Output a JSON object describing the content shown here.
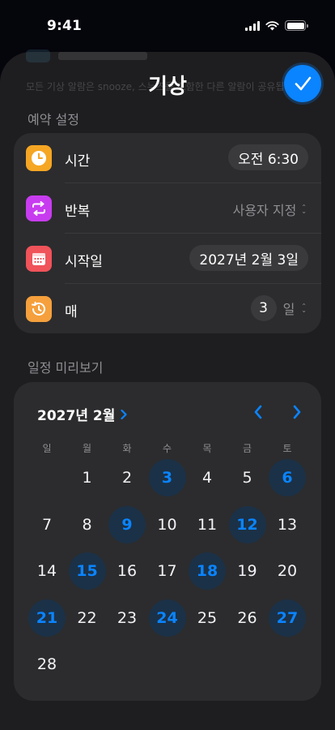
{
  "status": {
    "time": "9:41"
  },
  "sheet": {
    "title": "기상"
  },
  "background_peek": {
    "text": "모든 기상 알람은 snooze, 스누즈를 포함한 다른 알람이 공유됩니다"
  },
  "schedule_section": {
    "header": "예약 설정",
    "rows": [
      {
        "label": "시간",
        "value": "오전 6:30",
        "icon": "clock-icon",
        "icon_color": "#f5a623"
      },
      {
        "label": "반복",
        "value": "사용자 지정",
        "icon": "repeat-icon",
        "icon_color": "#c83cf0"
      },
      {
        "label": "시작일",
        "value": "2027년 2월 3일",
        "icon": "calendar-icon",
        "icon_color": "#f0535a"
      },
      {
        "label": "매",
        "value": "3",
        "unit": "일",
        "icon": "history-icon",
        "icon_color": "#f5a03c"
      }
    ]
  },
  "preview_section": {
    "header": "일정 미리보기",
    "month": "2027년 2월",
    "weekdays": [
      "일",
      "월",
      "화",
      "수",
      "목",
      "금",
      "토"
    ],
    "days": [
      "1",
      "2",
      "3",
      "4",
      "5",
      "6",
      "7",
      "8",
      "9",
      "10",
      "11",
      "12",
      "13",
      "14",
      "15",
      "16",
      "17",
      "18",
      "19",
      "20",
      "21",
      "22",
      "23",
      "24",
      "25",
      "26",
      "27",
      "28"
    ],
    "first_weekday_index": 1,
    "highlighted_days": [
      3,
      6,
      9,
      12,
      15,
      18,
      21,
      24,
      27
    ],
    "accent_color": "#0a84ff"
  }
}
